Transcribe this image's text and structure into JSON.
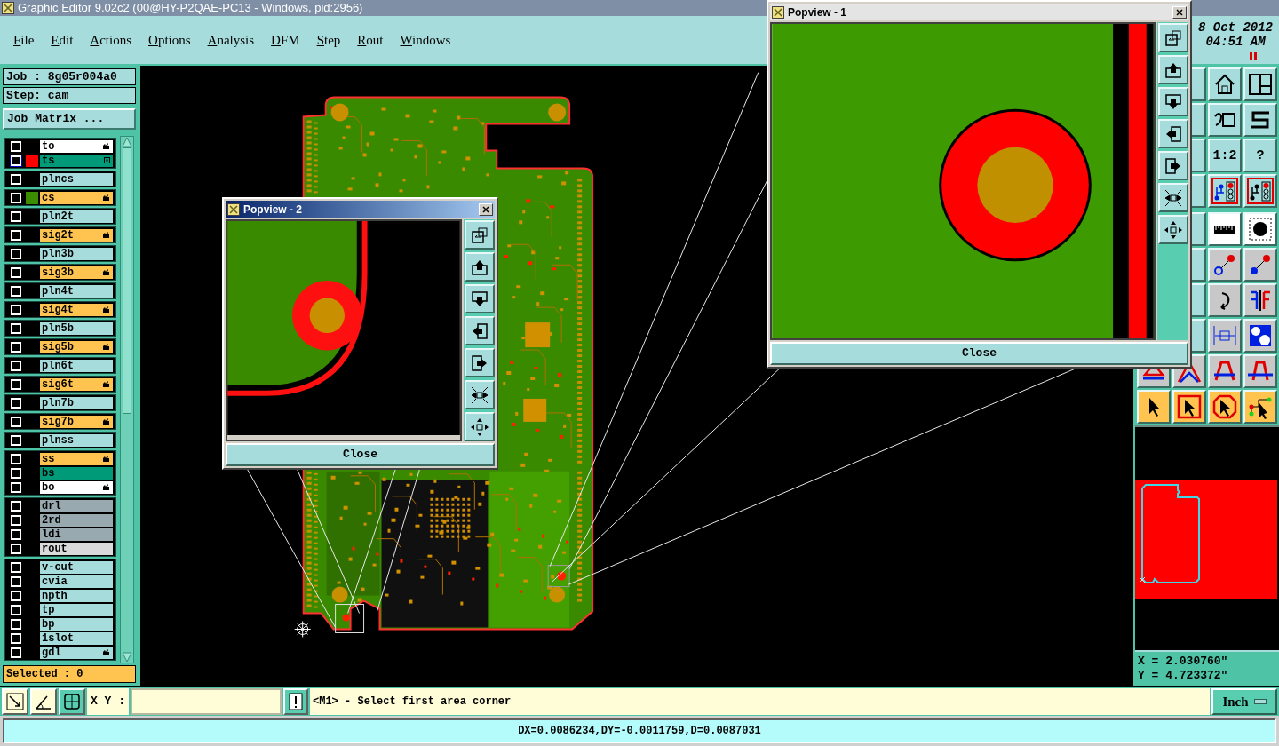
{
  "window": {
    "title": "Graphic Editor 9.02c2 (00@HY-P2QAE-PC13 - Windows, pid:2956)"
  },
  "menu": [
    "File",
    "Edit",
    "Actions",
    "Options",
    "Analysis",
    "DFM",
    "Step",
    "Rout",
    "Windows"
  ],
  "clock": {
    "date": "8 Oct 2012",
    "time": "04:51 AM",
    "paused": true
  },
  "job": {
    "job": "Job : 8g05r004a0",
    "step": "Step: cam",
    "matrix_button": "Job Matrix ..."
  },
  "layer_groups": [
    {
      "layers": [
        {
          "name": "to",
          "kind": "silk",
          "checked": false,
          "focused": false,
          "marker": {
            "kind": "hand"
          }
        },
        {
          "name": "ts",
          "kind": "mask",
          "checked": false,
          "focused": true,
          "color": "#ff0000",
          "marker": {
            "kind": "box"
          }
        }
      ]
    },
    {
      "layers": [
        {
          "name": "plncs",
          "kind": "plane",
          "checked": false,
          "focused": false
        }
      ]
    },
    {
      "layers": [
        {
          "name": "cs",
          "kind": "signal",
          "checked": false,
          "focused": false,
          "color": "#3c8c00",
          "marker": {
            "kind": "hand"
          }
        }
      ]
    },
    {
      "layers": [
        {
          "name": "pln2t",
          "kind": "plane",
          "checked": false,
          "focused": false
        }
      ]
    },
    {
      "layers": [
        {
          "name": "sig2t",
          "kind": "signal",
          "checked": false,
          "focused": false,
          "marker": {
            "kind": "hand"
          }
        }
      ]
    },
    {
      "layers": [
        {
          "name": "pln3b",
          "kind": "plane",
          "checked": false,
          "focused": false
        }
      ]
    },
    {
      "layers": [
        {
          "name": "sig3b",
          "kind": "signal",
          "checked": false,
          "focused": false,
          "marker": {
            "kind": "hand"
          }
        }
      ]
    },
    {
      "layers": [
        {
          "name": "pln4t",
          "kind": "plane",
          "checked": false,
          "focused": false
        }
      ]
    },
    {
      "layers": [
        {
          "name": "sig4t",
          "kind": "signal",
          "checked": false,
          "focused": false,
          "marker": {
            "kind": "hand"
          }
        }
      ]
    },
    {
      "layers": [
        {
          "name": "pln5b",
          "kind": "plane",
          "checked": false,
          "focused": false
        }
      ]
    },
    {
      "layers": [
        {
          "name": "sig5b",
          "kind": "signal",
          "checked": false,
          "focused": false,
          "marker": {
            "kind": "hand"
          }
        }
      ]
    },
    {
      "layers": [
        {
          "name": "pln6t",
          "kind": "plane",
          "checked": false,
          "focused": false
        }
      ]
    },
    {
      "layers": [
        {
          "name": "sig6t",
          "kind": "signal",
          "checked": false,
          "focused": false,
          "marker": {
            "kind": "hand"
          }
        }
      ]
    },
    {
      "layers": [
        {
          "name": "pln7b",
          "kind": "plane",
          "checked": false,
          "focused": false
        }
      ]
    },
    {
      "layers": [
        {
          "name": "sig7b",
          "kind": "signal",
          "checked": false,
          "focused": false,
          "marker": {
            "kind": "hand"
          }
        }
      ]
    },
    {
      "layers": [
        {
          "name": "plnss",
          "kind": "plane",
          "checked": false,
          "focused": false
        }
      ]
    },
    {
      "layers": [
        {
          "name": "ss",
          "kind": "signal",
          "checked": false,
          "focused": false,
          "marker": {
            "kind": "hand"
          }
        },
        {
          "name": "bs",
          "kind": "mask",
          "checked": false,
          "focused": false
        },
        {
          "name": "bo",
          "kind": "silk",
          "checked": false,
          "focused": false,
          "marker": {
            "kind": "hand"
          }
        }
      ]
    },
    {
      "layers": [
        {
          "name": "drl",
          "kind": "drill",
          "checked": false,
          "focused": false
        },
        {
          "name": "2rd",
          "kind": "drill",
          "checked": false,
          "focused": false
        },
        {
          "name": "ldi",
          "kind": "drill",
          "checked": false,
          "focused": false
        },
        {
          "name": "rout",
          "kind": "rout",
          "checked": false,
          "focused": false
        }
      ]
    },
    {
      "layers": [
        {
          "name": "v-cut",
          "kind": "plane",
          "checked": false,
          "focused": false
        },
        {
          "name": "cvia",
          "kind": "plane",
          "checked": false,
          "focused": false
        },
        {
          "name": "npth",
          "kind": "plane",
          "checked": false,
          "focused": false
        },
        {
          "name": "tp",
          "kind": "plane",
          "checked": false,
          "focused": false
        },
        {
          "name": "bp",
          "kind": "plane",
          "checked": false,
          "focused": false
        },
        {
          "name": "1slot",
          "kind": "plane",
          "checked": false,
          "focused": false
        },
        {
          "name": "gdl",
          "kind": "plane",
          "checked": false,
          "focused": false,
          "marker": {
            "kind": "hand"
          }
        }
      ]
    }
  ],
  "selected_count": "Selected : 0",
  "popviews": [
    {
      "title": "Popview - 2",
      "active": true,
      "kind": "arc",
      "close": "Close"
    },
    {
      "title": "Popview - 1",
      "active": false,
      "kind": "pad",
      "close": "Close"
    }
  ],
  "toolbar": [
    {
      "cells": [
        {
          "kind": "house"
        },
        {
          "kind": "panels"
        }
      ]
    },
    {
      "cells": [
        {
          "kind": "undo-frame"
        },
        {
          "kind": "s-curve"
        }
      ]
    },
    {
      "cells": [
        {
          "kind": "text",
          "label": "1:2"
        },
        {
          "kind": "text",
          "label": "?"
        }
      ]
    },
    {
      "cells": [
        {
          "kind": "layer-link-a"
        },
        {
          "kind": "layer-link-b"
        }
      ]
    },
    {
      "cells": [
        {
          "kind": "ruler"
        },
        {
          "kind": "dot"
        }
      ]
    },
    {
      "cells": [
        {
          "kind": "pad-outline"
        },
        {
          "kind": "pad-filled"
        }
      ]
    },
    {
      "cells": [
        {
          "kind": "curve-arrow"
        },
        {
          "kind": "mirror"
        }
      ]
    },
    {
      "cells": [
        {
          "kind": "dimension"
        },
        {
          "kind": "shapes"
        }
      ]
    },
    {
      "cells": [
        {
          "kind": "tri-small"
        },
        {
          "kind": "tri-peak"
        },
        {
          "kind": "tri-arch"
        },
        {
          "kind": "tri-cross"
        }
      ]
    },
    {
      "cells": [
        {
          "kind": "pointer"
        },
        {
          "kind": "pointer-frame"
        },
        {
          "kind": "pointer-octagon"
        },
        {
          "kind": "pointer-route"
        }
      ]
    }
  ],
  "coords": {
    "x": "X = 2.030760\"",
    "y": "Y = 4.723372\""
  },
  "command": {
    "label": "X Y :",
    "message": "<M1> - Select first area corner",
    "units": "Inch"
  },
  "status": "DX=0.0086234,DY=-0.0011759,D=0.0087031"
}
